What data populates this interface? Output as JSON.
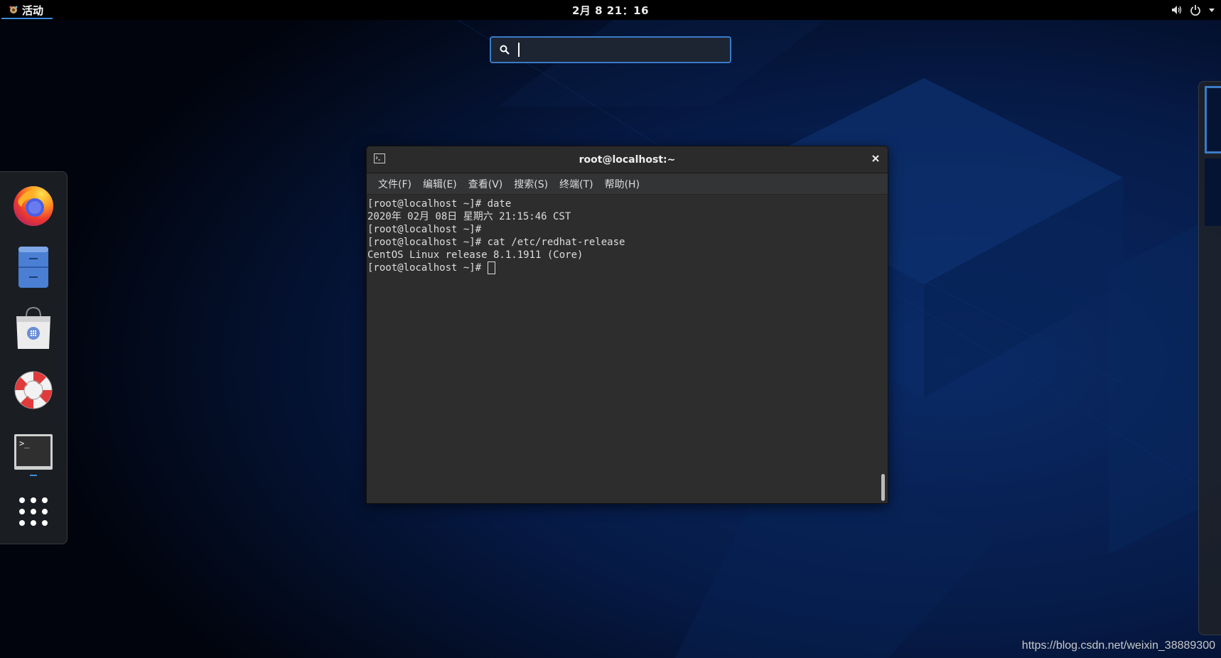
{
  "topbar": {
    "activities_label": "活动",
    "clock": "2月 8  21：16",
    "tray_icons": [
      "volume-icon",
      "power-icon",
      "chevron-down-icon"
    ]
  },
  "search": {
    "placeholder": "",
    "value": ""
  },
  "dock": {
    "items": [
      {
        "name": "firefox",
        "icon": "firefox-icon"
      },
      {
        "name": "files",
        "icon": "file-cabinet-icon"
      },
      {
        "name": "software",
        "icon": "shopping-bag-icon"
      },
      {
        "name": "help",
        "icon": "lifebuoy-icon"
      },
      {
        "name": "terminal",
        "icon": "terminal-icon",
        "running": true
      },
      {
        "name": "show-applications",
        "icon": "app-grid-icon"
      }
    ]
  },
  "terminal": {
    "title": "root@localhost:~",
    "menu": [
      "文件(F)",
      "编辑(E)",
      "查看(V)",
      "搜索(S)",
      "终端(T)",
      "帮助(H)"
    ],
    "lines": [
      "[root@localhost ~]# date",
      "2020年 02月 08日 星期六 21:15:46 CST",
      "[root@localhost ~]#",
      "[root@localhost ~]# cat /etc/redhat-release",
      "CentOS Linux release 8.1.1911 (Core)",
      "[root@localhost ~]# "
    ]
  },
  "watermark": "https://blog.csdn.net/weixin_38889300",
  "colors": {
    "accent": "#3b8de0",
    "terminal_bg": "#2d2d2d",
    "desktop_bg": "#020918"
  }
}
